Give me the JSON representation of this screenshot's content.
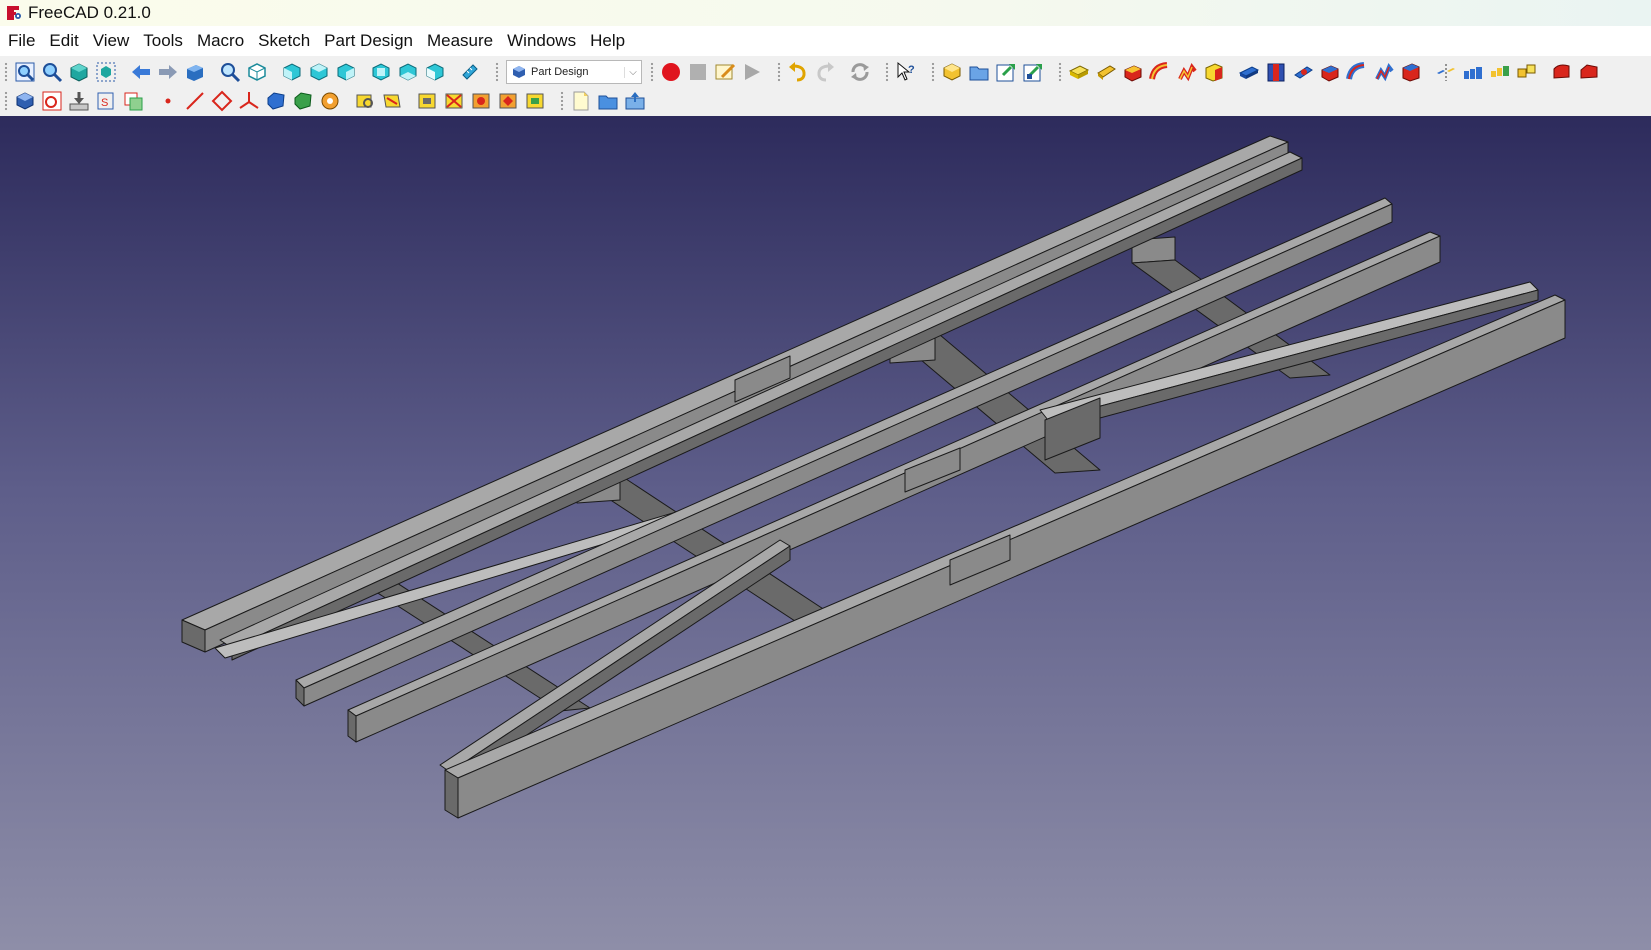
{
  "window": {
    "title": "FreeCAD 0.21.0"
  },
  "menubar": {
    "items": [
      "File",
      "Edit",
      "View",
      "Tools",
      "Macro",
      "Sketch",
      "Part Design",
      "Measure",
      "Windows",
      "Help"
    ]
  },
  "toolbar": {
    "workbench_selector": {
      "selected": "Part Design"
    }
  },
  "icons": {
    "row1": [
      "fit-all-icon",
      "fit-selection-icon",
      "draw-style-icon",
      "bounding-box-icon",
      "back-icon",
      "forward-icon",
      "std-view-icon",
      "zoom-icon",
      "isometric-icon",
      "front-view-icon",
      "top-view-icon",
      "right-view-icon",
      "rear-view-icon",
      "bottom-view-icon",
      "left-view-icon",
      "measure-icon",
      "record-macro-icon",
      "stop-macro-icon",
      "edit-macro-icon",
      "run-macro-icon",
      "undo-icon",
      "redo-icon",
      "refresh-icon",
      "whats-this-icon",
      "create-body-icon",
      "create-part-icon",
      "link-icon",
      "link-sub-icon",
      "pad-icon",
      "revolution-icon",
      "additive-loft-icon",
      "additive-pipe-icon",
      "additive-helix-icon",
      "additive-box-icon",
      "pocket-icon",
      "hole-icon",
      "groove-icon",
      "subtractive-loft-icon",
      "subtractive-pipe-icon",
      "subtractive-helix-icon",
      "subtractive-box-icon",
      "mirrored-icon",
      "linear-pattern-icon",
      "polar-pattern-icon",
      "multi-transform-icon",
      "fillet-icon",
      "chamfer-icon"
    ],
    "row2": [
      "body-icon",
      "new-sketch-icon",
      "attach-icon",
      "shape-binder-icon",
      "clone-icon",
      "datum-point-icon",
      "datum-line-icon",
      "datum-plane-icon",
      "local-coordinate-system-icon",
      "sub-shape-binder-icon",
      "boolean-icon",
      "move-tip-icon",
      "sketch-validate-icon",
      "draft-icon",
      "thickness-icon",
      "shaft-wizard-icon",
      "gear-icon",
      "sprocket-icon",
      "involute-icon",
      "new-document-icon",
      "open-document-icon",
      "save-icon"
    ]
  },
  "colors": {
    "viewport_top": "#2d2b5c",
    "viewport_bottom": "#8e8ea8",
    "beam_face_light": "#a8a8a8",
    "beam_face_mid": "#8a8a8a",
    "beam_face_dark": "#6a6a6a",
    "beam_edge": "#1a1a1a"
  }
}
